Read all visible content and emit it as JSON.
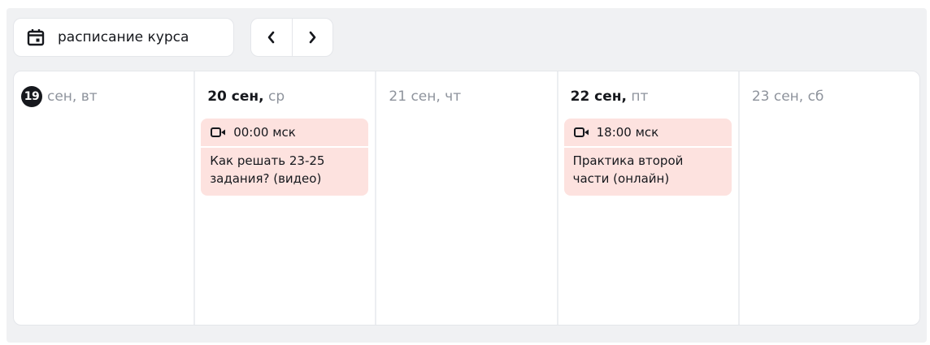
{
  "toolbar": {
    "schedule_label": "расписание курса",
    "schedule_icon": "calendar-icon",
    "prev_icon": "chevron-left-icon",
    "next_icon": "chevron-right-icon"
  },
  "days": [
    {
      "num": "19",
      "month": "сен,",
      "weekday": "вт",
      "today": true
    },
    {
      "date": "20 сен,",
      "weekday": "ср",
      "event": {
        "time": "00:00 мск",
        "title_line1": "Как решать 23-25",
        "title_line2": "задания? (видео)",
        "icon": "video-icon"
      }
    },
    {
      "date": "21 сен, чт"
    },
    {
      "date": "22 сен,",
      "weekday": "пт",
      "event": {
        "time": "18:00 мск",
        "title_line1": "Практика второй",
        "title_line2": "части (онлайн)",
        "icon": "video-icon"
      }
    },
    {
      "date": "23 сен, сб"
    }
  ],
  "colors": {
    "event_bg": "#fde2df",
    "today_badge": "#16181d",
    "muted_text": "#8e939c"
  }
}
